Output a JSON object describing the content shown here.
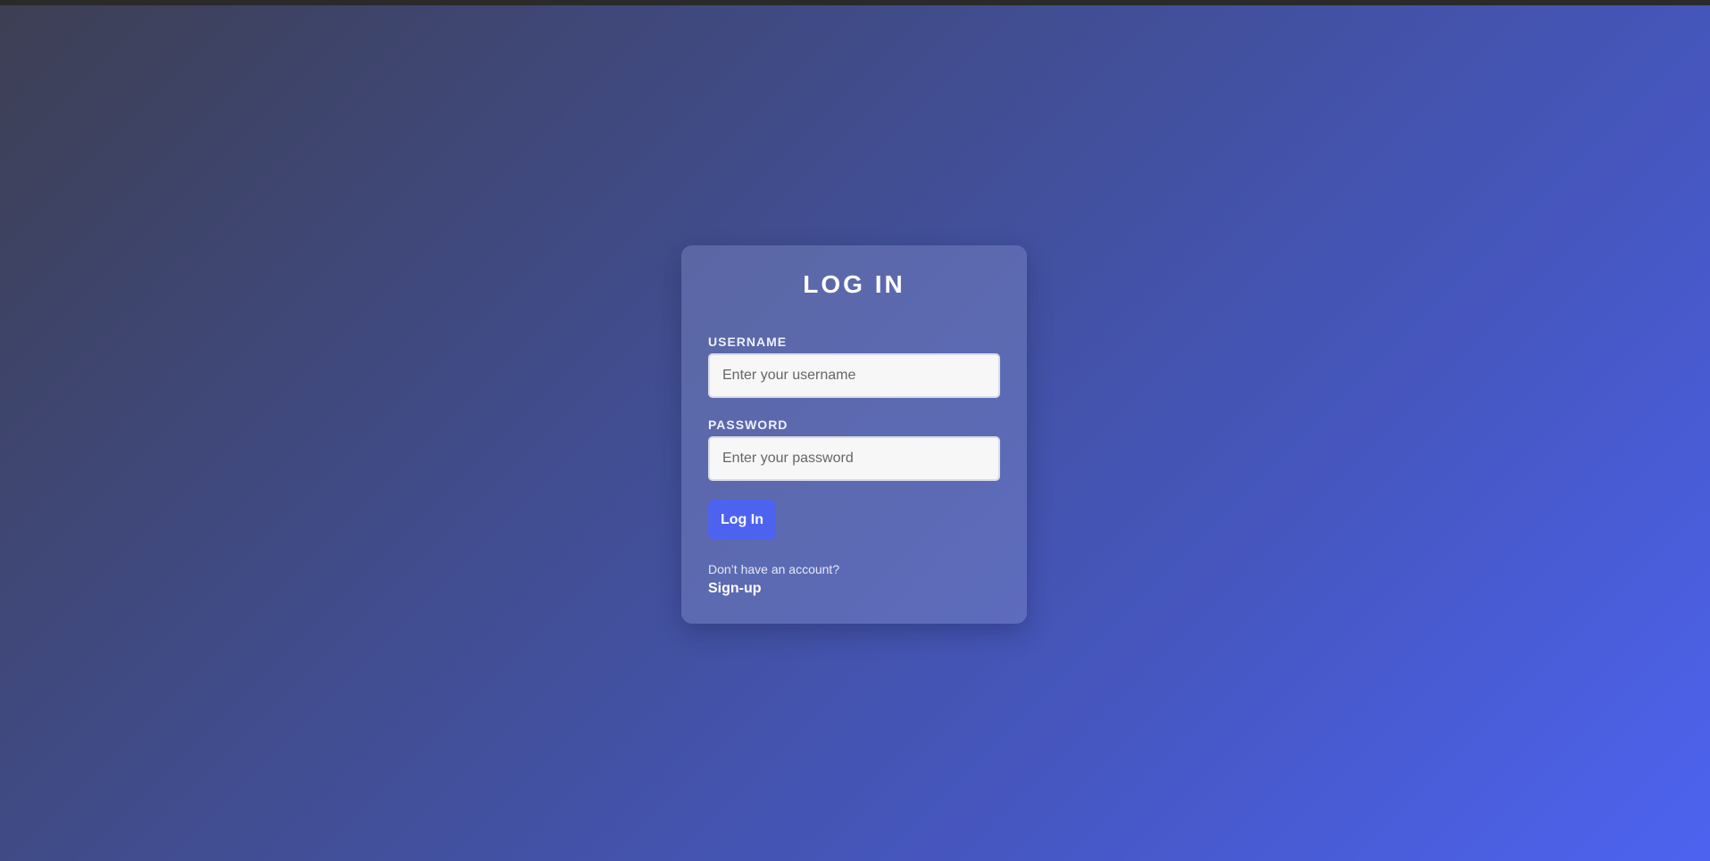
{
  "colors": {
    "accent": "#4d63f0",
    "background_start": "#3d3f53",
    "background_end": "#4d63f0"
  },
  "login": {
    "title": "LOG IN",
    "username": {
      "label": "USERNAME",
      "placeholder": "Enter your username",
      "value": ""
    },
    "password": {
      "label": "PASSWORD",
      "placeholder": "Enter your password",
      "value": ""
    },
    "submit_label": "Log In",
    "signup_prompt": "Don’t have an account?",
    "signup_link": "Sign-up"
  }
}
